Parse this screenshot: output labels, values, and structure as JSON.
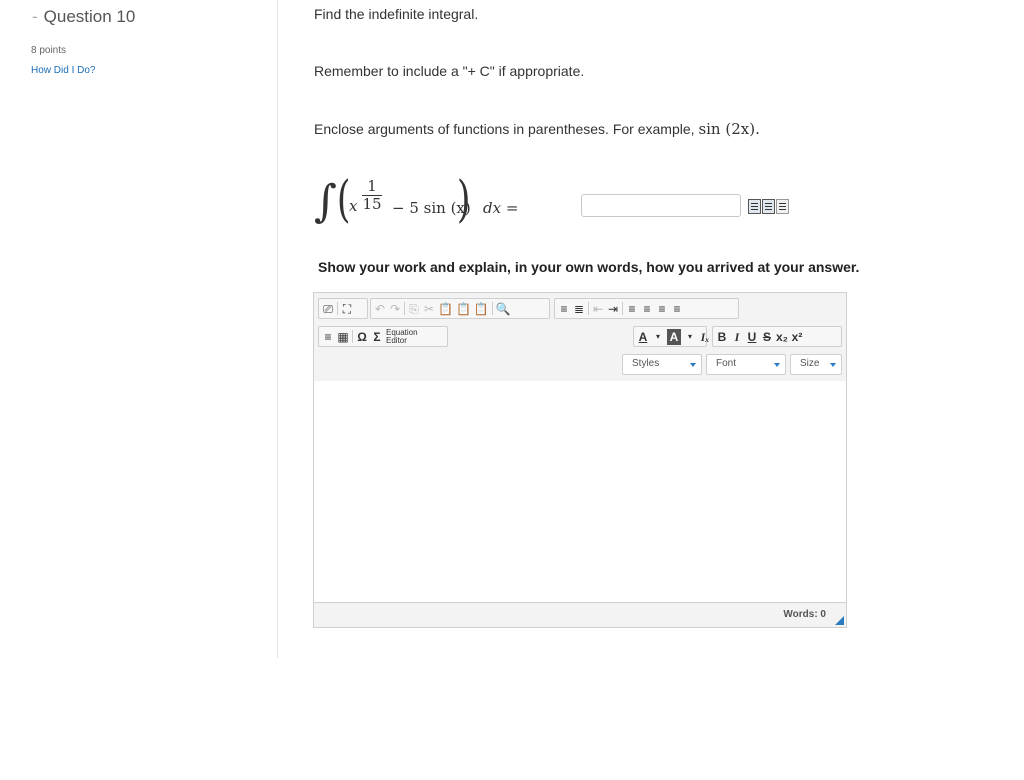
{
  "sidebar": {
    "dash": "-",
    "question_title": "Question 10",
    "points": "8 points",
    "how_did_i_do": "How Did I Do?"
  },
  "main": {
    "instruction_1": "Find the indefinite integral.",
    "instruction_2": "Remember to include a \"+ C\" if appropriate.",
    "instruction_3_text": "Enclose arguments of functions in parentheses. For example,",
    "instruction_3_example": "sin (2x).",
    "integral": {
      "sign": "∫",
      "left_paren": "(",
      "var": "x",
      "exp_num": "1",
      "exp_den": "15",
      "middle": "− 5 sin (x)",
      "right_paren": ")",
      "tail": "dx ="
    },
    "answer_value": "",
    "show_work": "Show your work and explain, in your own words, how you arrived at your answer."
  },
  "editor": {
    "toolbar_row1": [
      "⎚",
      "⛶",
      "↶",
      "↷",
      "⎘",
      "✂",
      "📋",
      "📋",
      "📋",
      "🔍",
      "≡",
      "≣",
      "⇤",
      "⇥",
      "≡",
      "≡",
      "≡",
      "≡"
    ],
    "table_icon": "▦",
    "omega": "Ω",
    "sigma": "Σ",
    "equation_editor_line1": "Equation",
    "equation_editor_line2": "Editor",
    "font_color": "A",
    "bg_color": "A",
    "clear_format": "Iₓ",
    "bold": "B",
    "italic": "I",
    "underline": "U",
    "strike": "S",
    "subscript": "x₂",
    "superscript": "x²",
    "styles_label": "Styles",
    "font_label": "Font",
    "size_label": "Size",
    "words_label": "Words: 0"
  },
  "colors": {
    "link": "#1a6eb6",
    "accent": "#2a7bc0"
  }
}
